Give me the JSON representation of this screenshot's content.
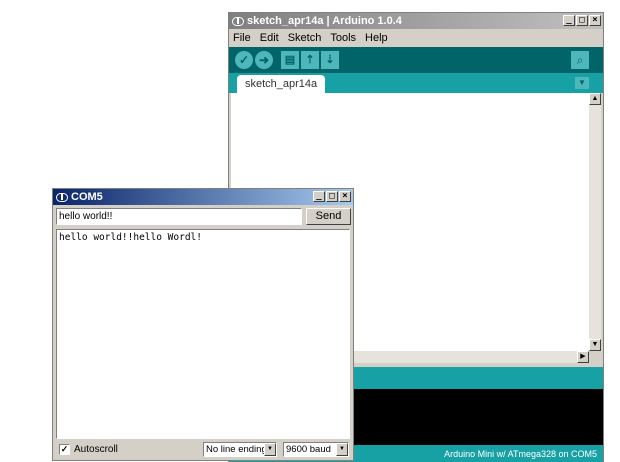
{
  "ide": {
    "title": "sketch_apr14a | Arduino 1.0.4",
    "menu": [
      "File",
      "Edit",
      "Sketch",
      "Tools",
      "Help"
    ],
    "toolbar": {
      "verify_icon": "✓",
      "upload_icon": "➜",
      "new_icon": "▤",
      "open_icon": "⇡",
      "save_icon": "⇣",
      "serial_icon": "⌕"
    },
    "tab_label": "sketch_apr14a",
    "status": "Arduino Mini w/ ATmega328 on COM5"
  },
  "serial": {
    "title": "COM5",
    "input_value": "hello world!!",
    "send_label": "Send",
    "output": "hello world!!hello Wordl!",
    "autoscroll_label": "Autoscroll",
    "autoscroll_checked": "✓",
    "line_ending": "No line ending",
    "baud": "9600 baud"
  },
  "window_buttons": {
    "minimize": "_",
    "maximize": "□",
    "close": "×"
  },
  "colors": {
    "toolbar": "#006468",
    "tabbar": "#17a1a5",
    "button": "#4db7bb",
    "console": "#000000",
    "serial_titlebar": "#0a246a"
  }
}
